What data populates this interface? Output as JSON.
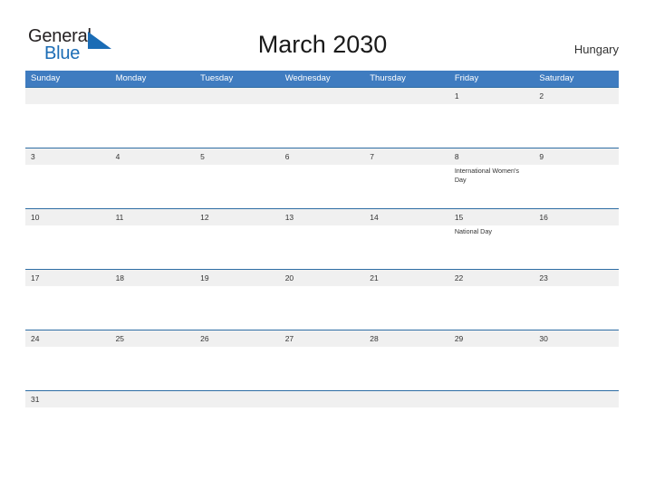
{
  "logo": {
    "word_one": "General",
    "word_two": "Blue",
    "flag_icon": "triangle-flag-icon"
  },
  "header": {
    "title": "March 2030",
    "country": "Hungary"
  },
  "colors": {
    "header_blue": "#3f7cc0",
    "divider_blue": "#2e6da4",
    "date_band_gray": "#f0f0f0",
    "logo_blue": "#1b6cb5",
    "text_dark": "#333333"
  },
  "calendar": {
    "weekday_headers": [
      "Sunday",
      "Monday",
      "Tuesday",
      "Wednesday",
      "Thursday",
      "Friday",
      "Saturday"
    ],
    "weeks": [
      {
        "days": [
          {
            "date": "",
            "event": ""
          },
          {
            "date": "",
            "event": ""
          },
          {
            "date": "",
            "event": ""
          },
          {
            "date": "",
            "event": ""
          },
          {
            "date": "",
            "event": ""
          },
          {
            "date": "1",
            "event": ""
          },
          {
            "date": "2",
            "event": ""
          }
        ]
      },
      {
        "days": [
          {
            "date": "3",
            "event": ""
          },
          {
            "date": "4",
            "event": ""
          },
          {
            "date": "5",
            "event": ""
          },
          {
            "date": "6",
            "event": ""
          },
          {
            "date": "7",
            "event": ""
          },
          {
            "date": "8",
            "event": "International Women's Day"
          },
          {
            "date": "9",
            "event": ""
          }
        ]
      },
      {
        "days": [
          {
            "date": "10",
            "event": ""
          },
          {
            "date": "11",
            "event": ""
          },
          {
            "date": "12",
            "event": ""
          },
          {
            "date": "13",
            "event": ""
          },
          {
            "date": "14",
            "event": ""
          },
          {
            "date": "15",
            "event": "National Day"
          },
          {
            "date": "16",
            "event": ""
          }
        ]
      },
      {
        "days": [
          {
            "date": "17",
            "event": ""
          },
          {
            "date": "18",
            "event": ""
          },
          {
            "date": "19",
            "event": ""
          },
          {
            "date": "20",
            "event": ""
          },
          {
            "date": "21",
            "event": ""
          },
          {
            "date": "22",
            "event": ""
          },
          {
            "date": "23",
            "event": ""
          }
        ]
      },
      {
        "days": [
          {
            "date": "24",
            "event": ""
          },
          {
            "date": "25",
            "event": ""
          },
          {
            "date": "26",
            "event": ""
          },
          {
            "date": "27",
            "event": ""
          },
          {
            "date": "28",
            "event": ""
          },
          {
            "date": "29",
            "event": ""
          },
          {
            "date": "30",
            "event": ""
          }
        ]
      },
      {
        "short": true,
        "days": [
          {
            "date": "31",
            "event": ""
          },
          {
            "date": "",
            "event": ""
          },
          {
            "date": "",
            "event": ""
          },
          {
            "date": "",
            "event": ""
          },
          {
            "date": "",
            "event": ""
          },
          {
            "date": "",
            "event": ""
          },
          {
            "date": "",
            "event": ""
          }
        ]
      }
    ]
  }
}
